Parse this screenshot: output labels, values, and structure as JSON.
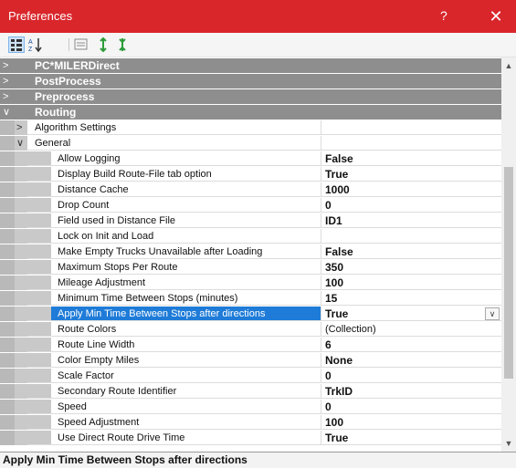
{
  "window": {
    "title": "Preferences",
    "help": "?",
    "close": "✕"
  },
  "toolbar": {
    "items": [
      {
        "name": "categorized-view-button",
        "icon": "categorized-icon",
        "active": true
      },
      {
        "name": "alphabetical-sort-button",
        "icon": "sort-az-icon",
        "active": false
      },
      {
        "name": "property-pages-button",
        "icon": "property-pages-icon",
        "active": false
      },
      {
        "name": "expand-all-button",
        "icon": "expand-icon",
        "active": false
      },
      {
        "name": "collapse-all-button",
        "icon": "collapse-icon",
        "active": false
      }
    ]
  },
  "grid": {
    "categories": [
      {
        "label": "PC*MILERDirect",
        "expanded": false
      },
      {
        "label": "PostProcess",
        "expanded": false
      },
      {
        "label": "Preprocess",
        "expanded": false
      },
      {
        "label": "Routing",
        "expanded": true
      }
    ],
    "subgroups": [
      {
        "label": "Algorithm Settings",
        "expanded": false
      },
      {
        "label": "General",
        "expanded": true
      }
    ],
    "properties": [
      {
        "label": "Allow Logging",
        "value": "False",
        "bold": true
      },
      {
        "label": "Display Build Route-File tab option",
        "value": "True",
        "bold": true
      },
      {
        "label": "Distance Cache",
        "value": "1000",
        "bold": true
      },
      {
        "label": "Drop Count",
        "value": "0",
        "bold": true
      },
      {
        "label": "Field used in Distance File",
        "value": "ID1",
        "bold": true
      },
      {
        "label": "Lock on Init and Load",
        "value": "",
        "bold": false
      },
      {
        "label": "Make Empty Trucks Unavailable after Loading",
        "value": "False",
        "bold": true
      },
      {
        "label": "Maximum Stops Per Route",
        "value": "350",
        "bold": true
      },
      {
        "label": "Mileage Adjustment",
        "value": "100",
        "bold": true
      },
      {
        "label": "Minimum Time Between Stops (minutes)",
        "value": "15",
        "bold": true
      },
      {
        "label": "Apply Min Time Between Stops after directions",
        "value": "True",
        "bold": true,
        "selected": true
      },
      {
        "label": "Route Colors",
        "value": "(Collection)",
        "bold": false
      },
      {
        "label": "Route Line Width",
        "value": "6",
        "bold": true
      },
      {
        "label": "Color Empty Miles",
        "value": "None",
        "bold": true
      },
      {
        "label": "Scale Factor",
        "value": "0",
        "bold": true
      },
      {
        "label": "Secondary Route Identifier",
        "value": "TrkID",
        "bold": true
      },
      {
        "label": "Speed",
        "value": "0",
        "bold": true
      },
      {
        "label": "Speed Adjustment",
        "value": "100",
        "bold": true
      },
      {
        "label": "Use Direct Route Drive Time",
        "value": "True",
        "bold": true
      }
    ]
  },
  "description": {
    "text": "Apply Min Time Between Stops after directions"
  },
  "colors": {
    "titlebar": "#d9262b",
    "selection": "#1e7bd8",
    "category": "#8e8e8e"
  }
}
